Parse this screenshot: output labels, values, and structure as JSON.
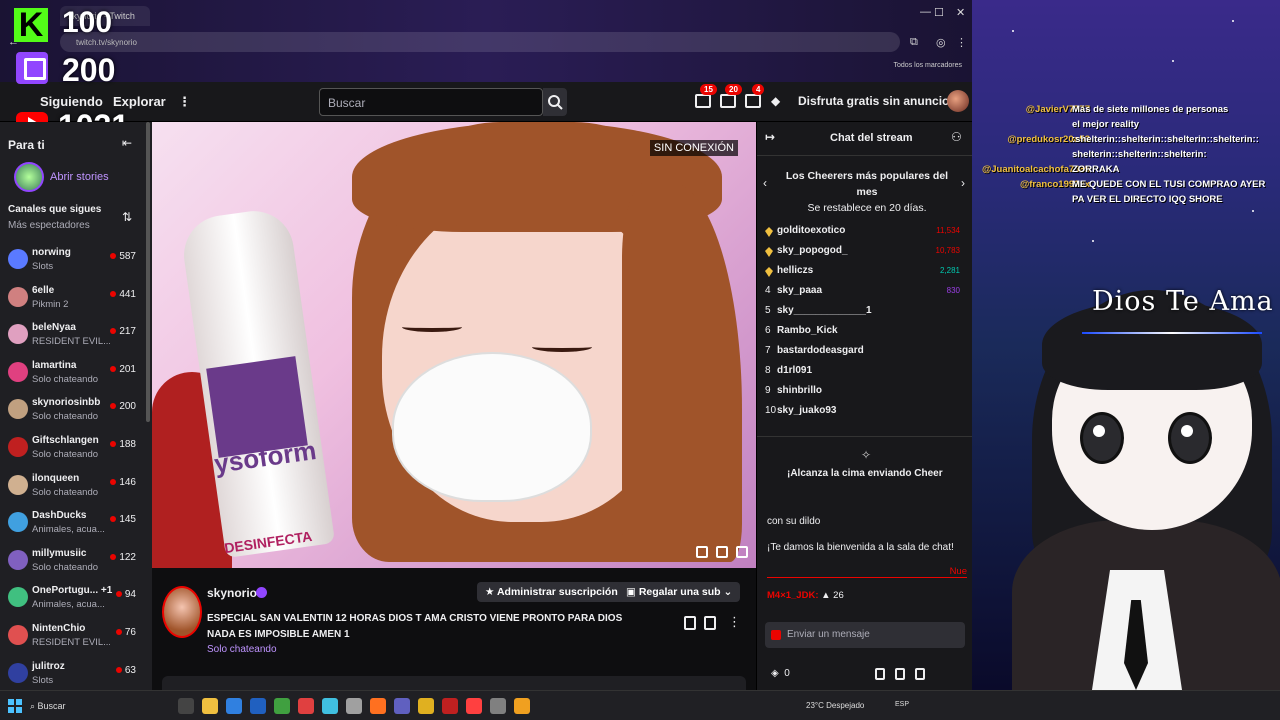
{
  "browser": {
    "tab_title": "skynorio - Twitch",
    "url": "twitch.tv/skynorio",
    "bookmarks": "Todos los marcadores"
  },
  "overlay_counters": {
    "kick": "100",
    "twitch": "200",
    "youtube": "1031"
  },
  "topnav": {
    "following": "Siguiendo",
    "explore": "Explorar",
    "more": "⋮",
    "search_placeholder": "Buscar",
    "badges": [
      "15",
      "20",
      "4"
    ],
    "turbo": "Disfruta gratis sin anuncios"
  },
  "sidebar": {
    "title": "Para ti",
    "stories": "Abrir stories",
    "heading": "Canales que sigues",
    "subheading": "Más espectadores",
    "channels": [
      {
        "name": "norwing",
        "game": "Slots",
        "viewers": "587",
        "color": "#5a7aff"
      },
      {
        "name": "6elle",
        "game": "Pikmin 2",
        "viewers": "441",
        "color": "#d08080"
      },
      {
        "name": "beleNyaa",
        "game": "RESIDENT EVIL...",
        "viewers": "217",
        "color": "#e0a0c0"
      },
      {
        "name": "lamartina",
        "game": "Solo chateando",
        "viewers": "201",
        "color": "#e04080"
      },
      {
        "name": "skynoriosinbb",
        "game": "Solo chateando",
        "viewers": "200",
        "color": "#c0a080"
      },
      {
        "name": "Giftschlangen",
        "game": "Solo chateando",
        "viewers": "188",
        "color": "#c02020"
      },
      {
        "name": "ilonqueen",
        "game": "Solo chateando",
        "viewers": "146",
        "color": "#d0b090"
      },
      {
        "name": "DashDucks",
        "game": "Animales, acua...",
        "viewers": "145",
        "color": "#40a0e0"
      },
      {
        "name": "millymusiic",
        "game": "Solo chateando",
        "viewers": "122",
        "color": "#8060c0"
      },
      {
        "name": "OnePortugu... +1",
        "game": "Animales, acua...",
        "viewers": "94",
        "color": "#40c080"
      },
      {
        "name": "NintenChio",
        "game": "RESIDENT EVIL...",
        "viewers": "76",
        "color": "#e05050"
      },
      {
        "name": "julitroz",
        "game": "Slots",
        "viewers": "63",
        "color": "#3040a0"
      }
    ]
  },
  "video": {
    "offline_badge": "SIN CONEXIÓN",
    "can_text": "ysoform",
    "can_subtext": "DESINFECTA"
  },
  "stream": {
    "channel": "skynorio",
    "title": "ESPECIAL SAN VALENTIN 12 HORAS DIOS T AMA CRISTO VIENE PRONTO PARA DIOS NADA ES IMPOSIBLE AMEN 1",
    "category": "Solo chateando",
    "subscription_button": "Administrar suscripción",
    "gift_button": "Regalar una sub"
  },
  "chat": {
    "header": "Chat del stream",
    "cheer_title": "Los Cheerers más populares del mes",
    "cheer_reset": "Se restablece en 20 días.",
    "cheerers": [
      {
        "rank": "",
        "name": "golditoexotico",
        "bits": "11,534",
        "color": "#eb0400"
      },
      {
        "rank": "",
        "name": "sky_popogod_",
        "bits": "10,783",
        "color": "#eb0400"
      },
      {
        "rank": "",
        "name": "helliczs",
        "bits": "2,281",
        "color": "#00c8af"
      },
      {
        "rank": "4",
        "name": "sky_paaa",
        "bits": "830",
        "color": "#9c3ee8"
      },
      {
        "rank": "5",
        "name": "sky_____________1",
        "bits": "",
        "color": "#9c3ee8"
      },
      {
        "rank": "6",
        "name": "Rambo_Kick",
        "bits": "",
        "color": "#efeff1"
      },
      {
        "rank": "7",
        "name": "bastardodeasgard",
        "bits": "",
        "color": "#efeff1"
      },
      {
        "rank": "8",
        "name": "d1rl091",
        "bits": "",
        "color": "#efeff1"
      },
      {
        "rank": "9",
        "name": "shinbrillo",
        "bits": "",
        "color": "#efeff1"
      },
      {
        "rank": "10",
        "name": "sky_juako93",
        "bits": "",
        "color": "#efeff1"
      }
    ],
    "cheer_cta": "¡Alcanza la cima enviando Cheer",
    "message_fragment": "con su dildo",
    "welcome": "¡Te damos la bienvenida a la sala de chat!",
    "new_label": "Nue",
    "last_user": "M4×1_JDK:",
    "last_count": "26",
    "input_placeholder": "Enviar un mensaje",
    "points": "0"
  },
  "overlay_chat": [
    {
      "user": "@JavierV7777",
      "msg": "Más de siete millones de personas"
    },
    {
      "user": "",
      "msg": "el mejor reality"
    },
    {
      "user": "@predukosr20o53",
      "msg": ":shelterin::shelterin::shelterin::shelterin::"
    },
    {
      "user": "",
      "msg": "shelterin::shelterin::shelterin:"
    },
    {
      "user": "@Juanitoalcachofa7385",
      "msg": "ZORRAKA"
    },
    {
      "user": "@franco1992xx",
      "msg": "ME QUEDE CON EL TUSI COMPRAO AYER"
    },
    {
      "user": "",
      "msg": "PA VER EL DIRECTO IQQ SHORE"
    }
  ],
  "overlay_text": "Dios Te Ama",
  "taskbar": {
    "search": "Buscar",
    "weather": "23°C  Despejado",
    "lang": "ESP"
  }
}
